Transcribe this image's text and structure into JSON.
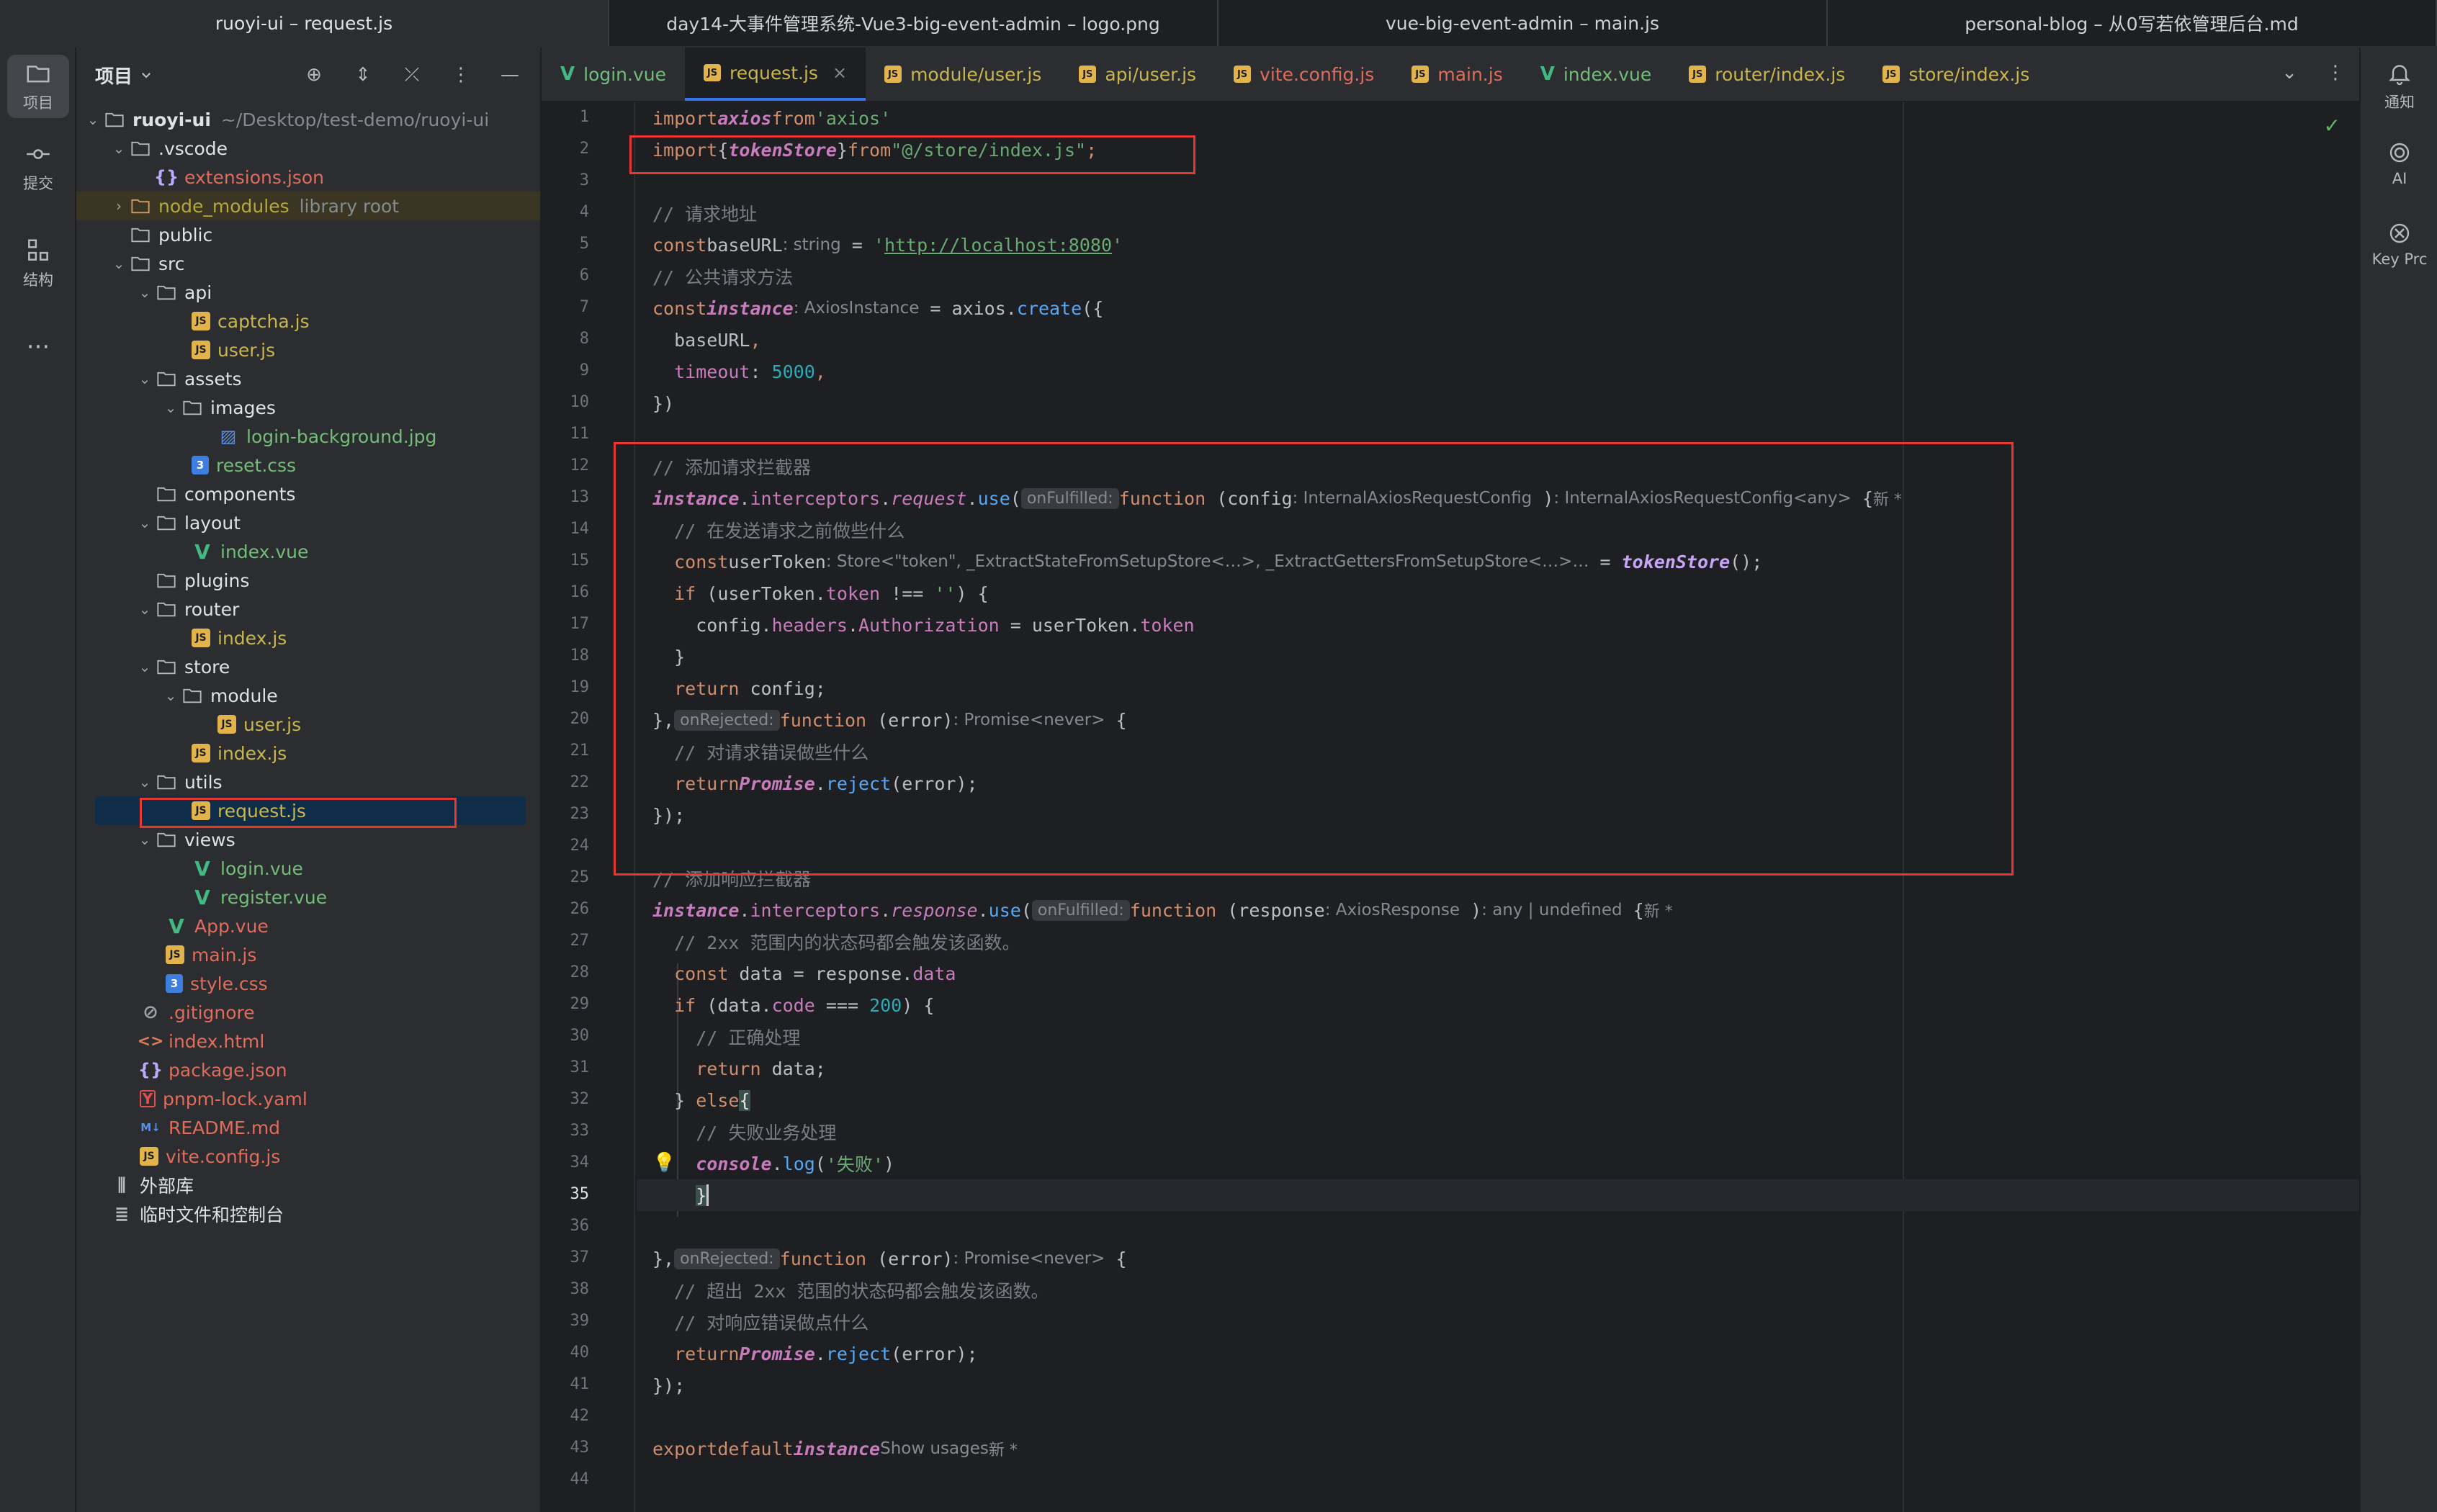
{
  "window_tabs": [
    "ruoyi-ui – request.js",
    "day14-大事件管理系统-Vue3-big-event-admin – logo.png",
    "vue-big-event-admin – main.js",
    "personal-blog – 从0写若依管理后台.md"
  ],
  "activity_bar": {
    "project_label": "项目",
    "commit_label": "提交",
    "structure_label": "结构",
    "more": "···"
  },
  "project_panel": {
    "title": "项目",
    "tree": [
      {
        "label": "ruoyi-ui",
        "extra": "~/Desktop/test-demo/ruoyi-ui"
      },
      {
        "label": ".vscode"
      },
      {
        "label": "extensions.json"
      },
      {
        "label": "node_modules",
        "extra": "library root"
      },
      {
        "label": "public"
      },
      {
        "label": "src"
      },
      {
        "label": "api"
      },
      {
        "label": "captcha.js"
      },
      {
        "label": "user.js"
      },
      {
        "label": "assets"
      },
      {
        "label": "images"
      },
      {
        "label": "login-background.jpg"
      },
      {
        "label": "reset.css"
      },
      {
        "label": "components"
      },
      {
        "label": "layout"
      },
      {
        "label": "index.vue"
      },
      {
        "label": "plugins"
      },
      {
        "label": "router"
      },
      {
        "label": "index.js"
      },
      {
        "label": "store"
      },
      {
        "label": "module"
      },
      {
        "label": "user.js"
      },
      {
        "label": "index.js"
      },
      {
        "label": "utils"
      },
      {
        "label": "request.js"
      },
      {
        "label": "views"
      },
      {
        "label": "login.vue"
      },
      {
        "label": "register.vue"
      },
      {
        "label": "App.vue"
      },
      {
        "label": "main.js"
      },
      {
        "label": "style.css"
      },
      {
        "label": ".gitignore"
      },
      {
        "label": "index.html"
      },
      {
        "label": "package.json"
      },
      {
        "label": "pnpm-lock.yaml"
      },
      {
        "label": "README.md"
      },
      {
        "label": "vite.config.js"
      },
      {
        "label": "外部库"
      },
      {
        "label": "临时文件和控制台"
      }
    ]
  },
  "editor_tabs": [
    {
      "label": "login.vue",
      "icon": "vue-icon"
    },
    {
      "label": "request.js",
      "icon": "js-icon",
      "active": true
    },
    {
      "label": "module/user.js",
      "icon": "js-icon"
    },
    {
      "label": "api/user.js",
      "icon": "js-icon"
    },
    {
      "label": "vite.config.js",
      "icon": "js-icon"
    },
    {
      "label": "main.js",
      "icon": "js-icon"
    },
    {
      "label": "index.vue",
      "icon": "vue-icon"
    },
    {
      "label": "router/index.js",
      "icon": "js-icon"
    },
    {
      "label": "store/index.js",
      "icon": "js-icon"
    }
  ],
  "code": {
    "line_numbers": [
      "1",
      "2",
      "3",
      "4",
      "5",
      "6",
      "7",
      "8",
      "9",
      "10",
      "11",
      "12",
      "13",
      "14",
      "15",
      "16",
      "17",
      "18",
      "19",
      "20",
      "21",
      "22",
      "23",
      "24",
      "25",
      "26",
      "27",
      "28",
      "29",
      "30",
      "31",
      "32",
      "33",
      "34",
      "35",
      "36",
      "37",
      "38",
      "39",
      "40",
      "41",
      "42",
      "43",
      "44"
    ],
    "current_line": "35",
    "l1": {
      "kw1": "import",
      "id": "axios",
      "kw2": "from",
      "str": "'axios'"
    },
    "l2": {
      "kw1": "import",
      "brace_open": "{",
      "id": "tokenStore",
      "brace_close": "}",
      "kw2": "from",
      "str": "\"@/store/index.js\"",
      "semi": ";"
    },
    "l4": "// 请求地址",
    "l5": {
      "kw": "const",
      "id": "baseURL",
      "hint": ": string",
      "eq": " = ",
      "q1": "'",
      "url": "http://localhost:8080",
      "q2": "'"
    },
    "l6": "// 公共请求方法",
    "l7": {
      "kw": "const",
      "id": "instance",
      "hint": ": AxiosInstance",
      "rest1": " = axios.",
      "fn": "create",
      "rest2": "({"
    },
    "l8": {
      "prop": "baseURL",
      "rest": ","
    },
    "l9": {
      "prop": "timeout",
      "colon": ": ",
      "num": "5000",
      "rest": ","
    },
    "l10": "})",
    "l12": "// 添加请求拦截器",
    "l13": {
      "id": "instance",
      "dot1": ".",
      "p1": "interceptors",
      "dot2": ".",
      "p2": "request",
      "dot3": ".",
      "fn": "use",
      "paren": "(",
      "label": "onFulfilled:",
      "kw": "function",
      "param": " (config",
      "hint1": ": InternalAxiosRequestConfig",
      "close": " )",
      "hint2": ": InternalAxiosRequestConfig<any>",
      "brace": " {",
      "new": "新 *"
    },
    "l14": "// 在发送请求之前做些什么",
    "l15": {
      "kw": "const",
      "id": "userToken",
      "hint": ": Store<\"token\", _ExtractStateFromSetupStore<…>, _ExtractGettersFromSetupStore<…>…",
      "eq": " = ",
      "fn": "tokenStore",
      "rest": "();"
    },
    "l16": {
      "kw": "if",
      "p1": " (userToken.",
      "prop": "token",
      "p2": " !== ",
      "str": "''",
      "p3": ") {"
    },
    "l17": {
      "p1": "config.",
      "prop1": "headers",
      "dot": ".",
      "prop2": "Authorization",
      "p2": " = userToken.",
      "prop3": "token"
    },
    "l18": "}",
    "l19": {
      "kw": "return",
      "rest": " config;"
    },
    "l20": {
      "p1": "},",
      "label": "onRejected:",
      "kw": "function",
      "param": " (error)",
      "hint": ": Promise<never>",
      "brace": " {"
    },
    "l21": "// 对请求错误做些什么",
    "l22": {
      "kw": "return",
      "id": "Promise",
      "dot": ".",
      "fn": "reject",
      "rest": "(error);"
    },
    "l23": "});",
    "l25": "// 添加响应拦截器",
    "l26": {
      "id": "instance",
      "dot1": ".",
      "p1": "interceptors",
      "dot2": ".",
      "p2": "response",
      "dot3": ".",
      "fn": "use",
      "paren": "(",
      "label": "onFulfilled:",
      "kw": "function",
      "param": " (response",
      "hint1": ": AxiosResponse",
      "close": " )",
      "hint2": ": any | undefined",
      "brace": " {",
      "new": "新 *"
    },
    "l27": "// 2xx 范围内的状态码都会触发该函数。",
    "l28": {
      "kw": "const",
      "p1": " data = response.",
      "prop": "data"
    },
    "l29": {
      "kw": "if",
      "p1": " (data.",
      "prop": "code",
      "p2": " === ",
      "num": "200",
      "p3": ") {"
    },
    "l30": "// 正确处理",
    "l31": {
      "kw": "return",
      "rest": " data;"
    },
    "l32": {
      "p1": "} ",
      "kw": "else",
      "brace": "{"
    },
    "l33": "// 失败业务处理",
    "l34": {
      "id": "console",
      "dot": ".",
      "fn": "log",
      "p1": "(",
      "str": "'失败'",
      "p2": ")"
    },
    "l35": "}",
    "l37": {
      "p1": "},",
      "label": "onRejected:",
      "kw": "function",
      "param": " (error)",
      "hint": ": Promise<never>",
      "brace": " {"
    },
    "l38": "// 超出 2xx 范围的状态码都会触发该函数。",
    "l39": "// 对响应错误做点什么",
    "l40": {
      "kw": "return",
      "id": "Promise",
      "dot": ".",
      "fn": "reject",
      "rest": "(error);"
    },
    "l41": "});",
    "l43": {
      "kw1": "export",
      "kw2": "default",
      "id": "instance",
      "hint": "Show usages",
      "new": "新 *"
    }
  },
  "right_bar": {
    "notifications_label": "通知",
    "ai_label": "AI",
    "key_promoter_label": "Key Prc"
  },
  "colors": {
    "accent": "#3574f0",
    "highlight_box": "#e8372e",
    "keyword": "#cf8e6d",
    "string": "#6aab73",
    "comment": "#7a7e85"
  }
}
